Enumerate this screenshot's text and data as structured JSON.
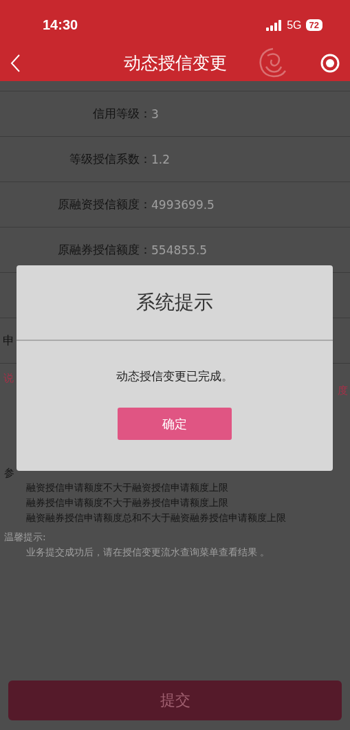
{
  "status_bar": {
    "time": "14:30",
    "network": "5G",
    "battery": "72"
  },
  "nav": {
    "title": "动态授信变更"
  },
  "rows": [
    {
      "label": "信用等级：",
      "value": "3"
    },
    {
      "label": "等级授信系数：",
      "value": "1.2"
    },
    {
      "label": "原融资授信额度：",
      "value": "4993699.5"
    },
    {
      "label": "原融券授信额度：",
      "value": "554855.5"
    }
  ],
  "apply_label": "申",
  "note_left": "说",
  "note_right": "度",
  "reference": {
    "title": "参",
    "items": [
      "融资授信申请额度不大于融资授信申请额度上限",
      "融券授信申请额度不大于融券授信申请额度上限",
      "融资融券授信申请额度总和不大于融资融券授信申请额度上限"
    ]
  },
  "tips": {
    "title": "温馨提示:",
    "text": "业务提交成功后，请在授信变更流水查询菜单查看结果 。"
  },
  "submit": "提交",
  "dialog": {
    "title": "系统提示",
    "message": "动态授信变更已完成。",
    "button": "确定"
  }
}
